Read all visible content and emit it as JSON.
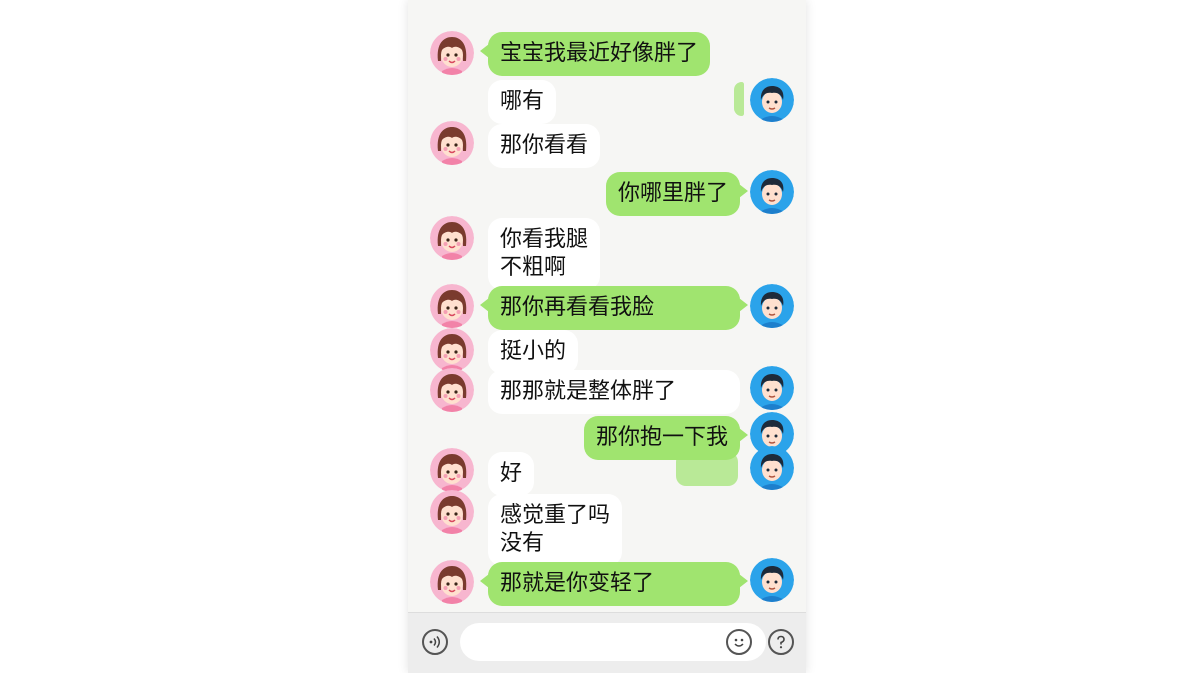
{
  "colors": {
    "green_bubble": "#a0e46f",
    "white_bubble": "#ffffff",
    "background": "#f6f6f4"
  },
  "messages": [
    {
      "sender": "girl",
      "color": "green",
      "text": "宝宝我最近好像胖了"
    },
    {
      "sender": "girl",
      "color": "white",
      "text": "哪有"
    },
    {
      "sender": "girl",
      "color": "white",
      "text": "那你看看"
    },
    {
      "sender": "boy",
      "color": "green",
      "text": "你哪里胖了"
    },
    {
      "sender": "girl",
      "color": "white",
      "text": "你看我腿\n不粗啊"
    },
    {
      "sender": "both",
      "color": "green",
      "text": "那你再看看我脸"
    },
    {
      "sender": "girl",
      "color": "white",
      "text": "挺小的"
    },
    {
      "sender": "both",
      "color": "white",
      "text": "那那就是整体胖了"
    },
    {
      "sender": "boy",
      "color": "green",
      "text": "那你抱一下我"
    },
    {
      "sender": "girl",
      "color": "white",
      "text": "好"
    },
    {
      "sender": "girl",
      "color": "white",
      "text": "感觉重了吗\n没有"
    },
    {
      "sender": "both",
      "color": "green",
      "text": "那就是你变轻了"
    }
  ],
  "avatars": {
    "girl": "girl-avatar-icon",
    "boy": "boy-avatar-icon"
  },
  "input_bar": {
    "voice_icon": "voice-icon",
    "emoji_icon": "emoji-icon",
    "help_icon": "question-icon",
    "input_value": ""
  }
}
